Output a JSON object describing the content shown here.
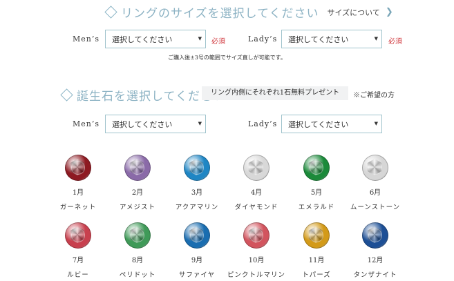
{
  "ring_size": {
    "title": "リングのサイズを選択してください",
    "about_link": "サイズについて",
    "mens_label": "Men’s",
    "ladys_label": "Lady’s",
    "mens_select": "選択してください",
    "ladys_select": "選択してください",
    "required": "必須",
    "note": "ご購入後±3号の範囲でサイズ直しが可能です。"
  },
  "birthstone": {
    "title": "誕生石を選択してください",
    "badge": "リング内側にそれぞれ1石無料プレゼント",
    "hint": "※ご希望の方",
    "mens_label": "Men’s",
    "ladys_label": "Lady’s",
    "mens_select": "選択してください",
    "ladys_select": "選択してください",
    "stones": [
      {
        "month": "1月",
        "name": "ガーネット",
        "color": "#8e1a22"
      },
      {
        "month": "2月",
        "name": "アメジスト",
        "color": "#8a6aa8"
      },
      {
        "month": "3月",
        "name": "アクアマリン",
        "color": "#1f86c4"
      },
      {
        "month": "4月",
        "name": "ダイヤモンド",
        "color": "#d8d8d8"
      },
      {
        "month": "5月",
        "name": "エメラルド",
        "color": "#1b8a3a"
      },
      {
        "month": "6月",
        "name": "ムーンストーン",
        "color": "#d6d6d6"
      },
      {
        "month": "7月",
        "name": "ルビー",
        "color": "#c8404e"
      },
      {
        "month": "8月",
        "name": "ペリドット",
        "color": "#3f9a58"
      },
      {
        "month": "9月",
        "name": "サファイヤ",
        "color": "#1a6db0"
      },
      {
        "month": "10月",
        "name": "ピンクトルマリン",
        "color": "#d2545e"
      },
      {
        "month": "11月",
        "name": "トパーズ",
        "color": "#d39a18"
      },
      {
        "month": "12月",
        "name": "タンザナイト",
        "color": "#1d4f95"
      }
    ]
  },
  "colors": {
    "accent": "#8db3c4",
    "required": "#d0373c",
    "select_border": "#9fc3cc"
  }
}
